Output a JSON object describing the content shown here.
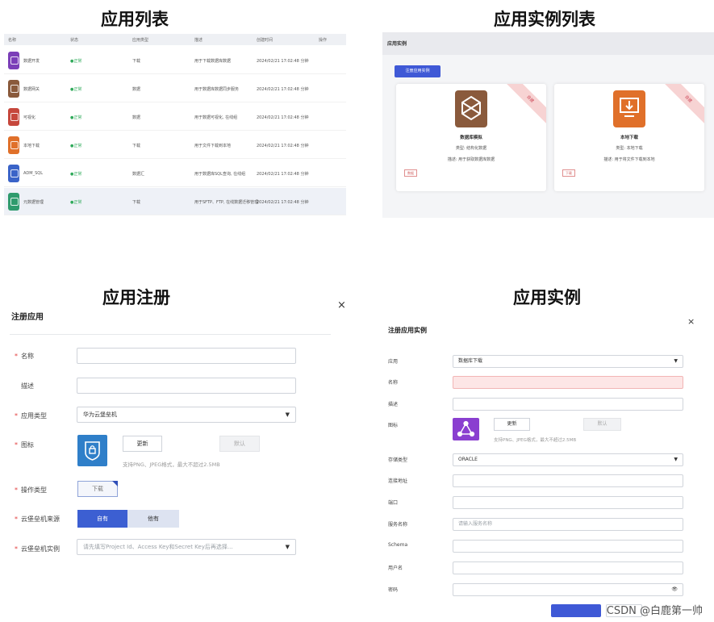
{
  "titles": {
    "app_list": "应用列表",
    "instance_list": "应用实例列表",
    "app_register": "应用注册",
    "app_instance": "应用实例"
  },
  "app_list": {
    "columns": [
      "名称",
      "状态",
      "应用类型",
      "描述",
      "创建时间",
      "操作"
    ],
    "rows": [
      {
        "name": "数据开发",
        "status": "●正常",
        "type": "下载",
        "desc": "用于下载数据库数据",
        "time": "2024/02/21 17:02:48 分钟",
        "color": "#7b3fb8"
      },
      {
        "name": "数据网关",
        "status": "●正常",
        "type": "数据",
        "desc": "用于数据库数据同步服务",
        "time": "2024/02/21 17:02:48 分钟",
        "color": "#8a5a3c"
      },
      {
        "name": "可视化",
        "status": "●正常",
        "type": "数据",
        "desc": "用于数据可视化, 在线组",
        "time": "2024/02/21 17:02:48 分钟",
        "color": "#c6473c"
      },
      {
        "name": "本地下载",
        "status": "●正常",
        "type": "下载",
        "desc": "用于文件下载到本地",
        "time": "2024/02/21 17:02:48 分钟",
        "color": "#e0702a"
      },
      {
        "name": "ADM_SQL",
        "status": "●正常",
        "type": "数据汇",
        "desc": "用于数据库SQL查询, 在线组",
        "time": "2024/02/21 17:02:48 分钟",
        "color": "#3a63c8"
      },
      {
        "name": "元数据管理",
        "status": "●正常",
        "type": "下载",
        "desc": "用于SFTP、FTP, 在线数据迁移管理",
        "time": "2024/02/21 17:02:48 分钟",
        "color": "#2f9b6d"
      }
    ]
  },
  "instance_list": {
    "header": "应用实例",
    "register_button": "注册应用实例",
    "cards": [
      {
        "name": "数据库模拟",
        "type": "类型: 结构化数据",
        "desc": "描述: 用于获取数据库数据",
        "tag": "数据",
        "ribbon": "自建",
        "color": "#8a5a3c"
      },
      {
        "name": "本地下载",
        "type": "类型: 本地下载",
        "desc": "描述: 用于将文件下载到本地",
        "tag": "下载",
        "ribbon": "自建",
        "color": "#e0702a"
      }
    ]
  },
  "register_form": {
    "dialog_title": "注册应用",
    "close": "×",
    "fields": {
      "name_label": "名称",
      "desc_label": "描述",
      "type_label": "应用类型",
      "type_value": "华为云堡垒机",
      "icon_label": "图标",
      "icon_change": "更新",
      "icon_default": "默认",
      "icon_hint": "支持PNG、JPEG格式，最大不超过2.5MB",
      "op_label": "操作类型",
      "op_value": "下载",
      "source_label": "云堡垒机来源",
      "source_options": [
        "自有",
        "他有"
      ],
      "instance_label": "云堡垒机实例",
      "instance_placeholder": "请先填写Project Id、Access Key和Secret Key后再选择..."
    }
  },
  "instance_form": {
    "dialog_title": "注册应用实例",
    "close": "×",
    "fields": [
      {
        "label": "应用",
        "value": "数据库下载",
        "kind": "select"
      },
      {
        "label": "名称",
        "value": "",
        "kind": "error"
      },
      {
        "label": "描述",
        "value": "",
        "kind": "text"
      },
      {
        "label": "存储类型",
        "value": "ORACLE",
        "kind": "select"
      },
      {
        "label": "连接地址",
        "value": "",
        "kind": "text"
      },
      {
        "label": "端口",
        "value": "",
        "kind": "text"
      },
      {
        "label": "服务名称",
        "value": "请输入服务名称",
        "kind": "placeholder"
      },
      {
        "label": "Schema",
        "value": "",
        "kind": "text"
      },
      {
        "label": "用户名",
        "value": "",
        "kind": "text"
      },
      {
        "label": "密码",
        "value": "",
        "kind": "password"
      }
    ],
    "icon_label": "图标",
    "icon_change": "更新",
    "icon_default": "默认",
    "icon_hint": "支持PNG、JPEG格式，最大不超过2.5MB",
    "icon_color": "#8a3fd0",
    "password_eye": "👁"
  },
  "watermark": "CSDN @白鹿第一帅"
}
